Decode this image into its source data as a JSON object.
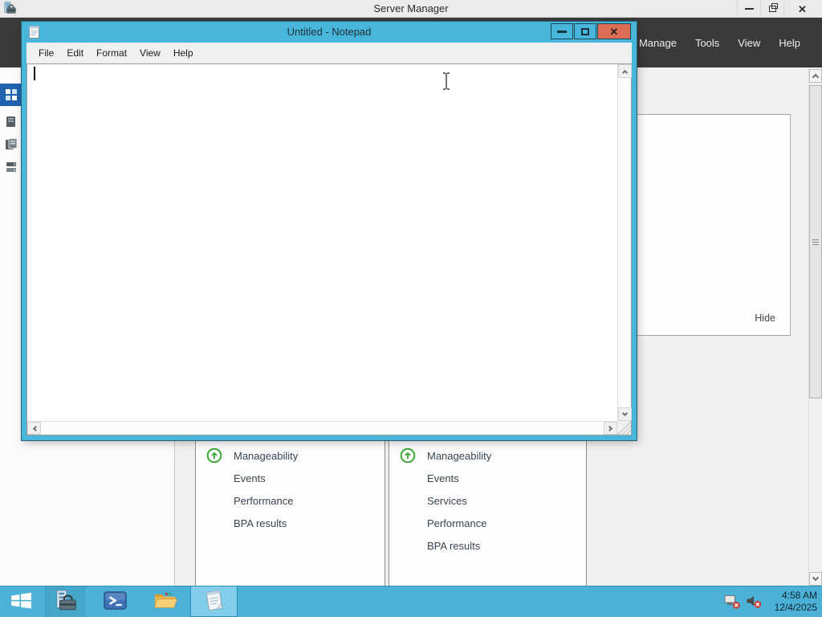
{
  "colors": {
    "accent_cyan": "#48b6da",
    "taskbar_cyan": "#4bb1d6",
    "close_red": "#dd6e55",
    "command_bar_dark": "#3a3a3a",
    "status_green": "#3aa935",
    "selected_blue": "#1f62b0"
  },
  "server_manager": {
    "title": "Server Manager",
    "menu": [
      "Manage",
      "Tools",
      "View",
      "Help"
    ],
    "welcome_panel": {
      "hide_label": "Hide"
    },
    "tiles": [
      {
        "items": [
          {
            "label": "Manageability",
            "icon": "green-up-circle"
          },
          {
            "label": "Events"
          },
          {
            "label": "Performance"
          },
          {
            "label": "BPA results"
          }
        ]
      },
      {
        "items": [
          {
            "label": "Manageability",
            "icon": "green-up-circle"
          },
          {
            "label": "Events"
          },
          {
            "label": "Services"
          },
          {
            "label": "Performance"
          },
          {
            "label": "BPA results"
          }
        ]
      }
    ],
    "sidebar_icons": [
      "dashboard",
      "local-server",
      "all-servers",
      "file-and-storage-services"
    ]
  },
  "notepad": {
    "title": "Untitled - Notepad",
    "menu": [
      "File",
      "Edit",
      "Format",
      "View",
      "Help"
    ],
    "text": ""
  },
  "taskbar": {
    "icons": [
      "windows-start",
      "server-manager",
      "powershell",
      "file-explorer",
      "notepad"
    ],
    "tray": {
      "icons": [
        "network-disconnected",
        "volume-muted"
      ],
      "time": "4:58 AM",
      "date": "12/4/2025"
    }
  },
  "glyphs": {
    "close": "✕"
  }
}
